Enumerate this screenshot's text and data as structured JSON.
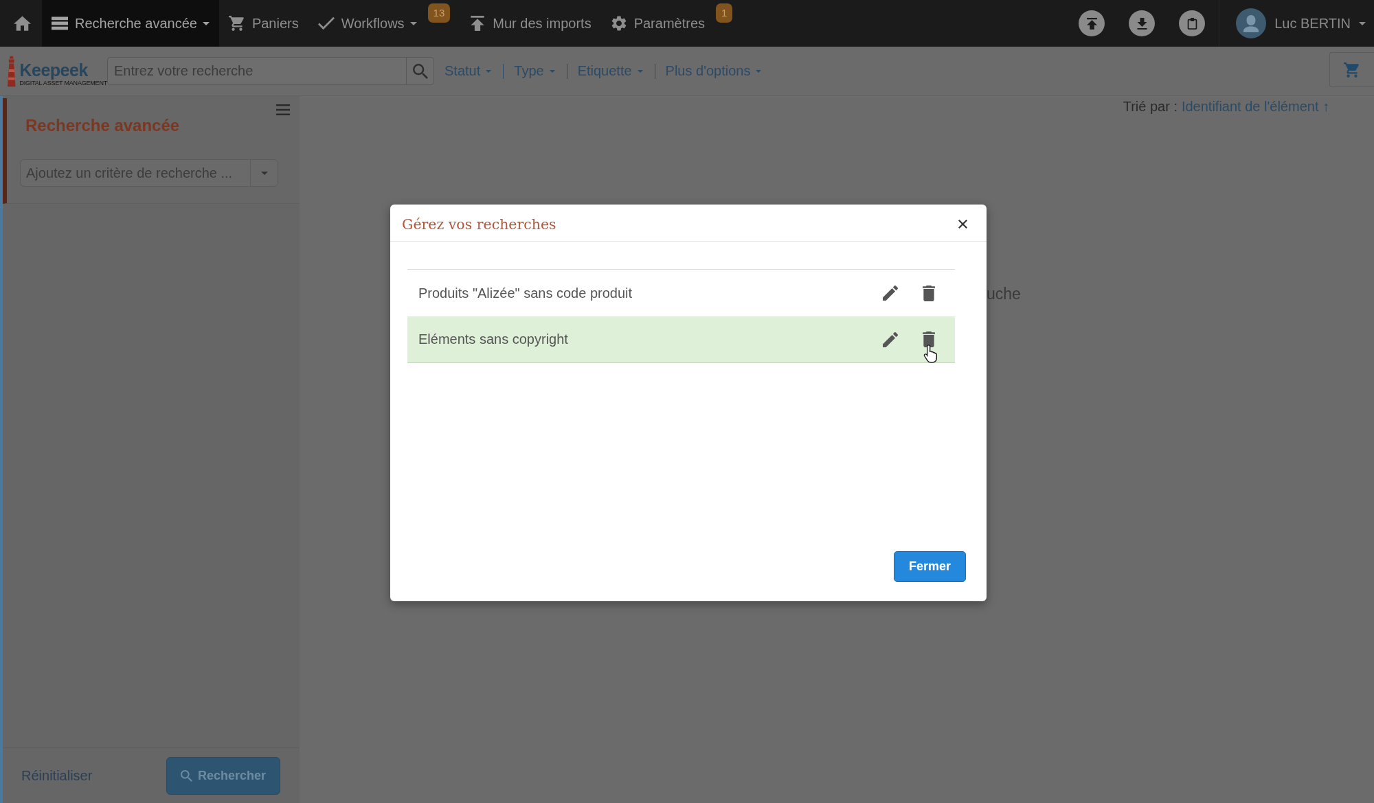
{
  "top_nav": {
    "items": [
      {
        "label": "Recherche avancée",
        "selected": true,
        "dropdown": true
      },
      {
        "label": "Paniers",
        "selected": false,
        "dropdown": false
      },
      {
        "label": "Workflows",
        "selected": false,
        "dropdown": true,
        "badge": "13"
      },
      {
        "label": "Mur des imports",
        "selected": false,
        "dropdown": false
      },
      {
        "label": "Paramètres",
        "selected": false,
        "dropdown": false,
        "badge": "1"
      }
    ],
    "user": {
      "name": "Luc BERTIN"
    }
  },
  "search_bar": {
    "logo": "Keepeek",
    "tagline": "DIGITAL ASSET MANAGEMENT",
    "search": {
      "placeholder": "Entrez votre recherche"
    },
    "filters": [
      "Statut",
      "Type",
      "Etiquette",
      "Plus d'options"
    ]
  },
  "sidebar": {
    "title": "Recherche avancée",
    "criteria": {
      "placeholder": "Ajoutez un critère de recherche ..."
    },
    "reset": "Réinitialiser",
    "search_button": "Rechercher"
  },
  "results": {
    "sort_label": "Trié par :",
    "sort_value": "Identifiant de l'élément ↑",
    "message": "uche"
  },
  "modal": {
    "title": "Gérez vos recherches",
    "searches": [
      {
        "name": "Produits \"Alizée\" sans code produit",
        "selected": false
      },
      {
        "name": "Eléments sans copyright",
        "selected": true
      }
    ],
    "close_button": "Fermer"
  }
}
